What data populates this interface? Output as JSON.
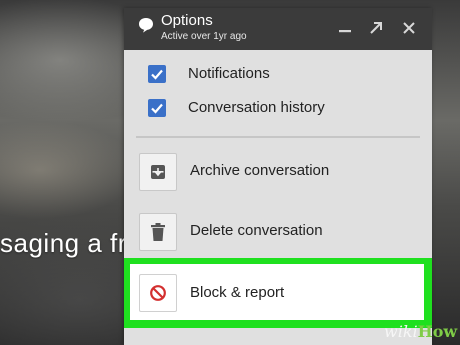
{
  "background": {
    "visible_text": "saging a fr"
  },
  "panel": {
    "title": "Options",
    "subtitle": "Active over 1yr ago",
    "header_icon": "speech-bubble-icon",
    "window_controls": [
      "minimize-icon",
      "expand-icon",
      "close-icon"
    ]
  },
  "checkboxes": [
    {
      "label": "Notifications",
      "checked": true
    },
    {
      "label": "Conversation history",
      "checked": true
    }
  ],
  "actions": [
    {
      "label": "Archive conversation",
      "icon": "archive-icon"
    },
    {
      "label": "Delete conversation",
      "icon": "trash-icon"
    }
  ],
  "block_report": {
    "label": "Block & report",
    "icon": "no-entry-icon",
    "highlight_color": "#1fe01f"
  },
  "colors": {
    "header": "#3b3b3b",
    "panel": "#e0e0e0",
    "checkbox": "#3a70c8",
    "block_icon": "#d32f2f"
  },
  "watermark": {
    "wiki": "wiki",
    "how": "How"
  }
}
